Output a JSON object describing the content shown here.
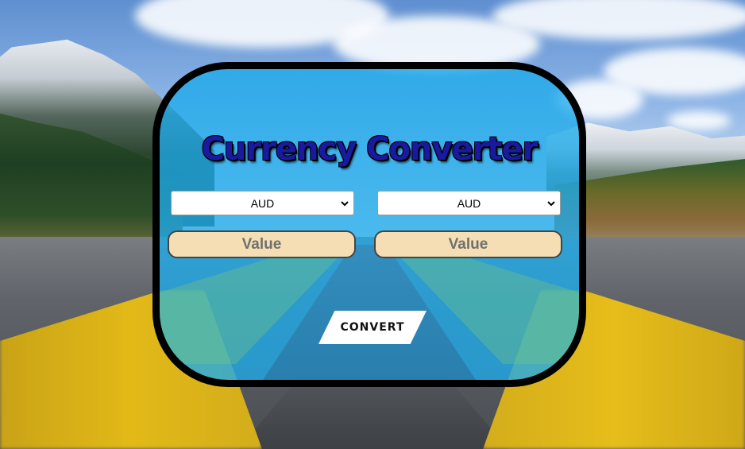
{
  "converter": {
    "title": "Currency Converter",
    "from_select": {
      "selected": "AUD",
      "icon": "chevron-down-icon"
    },
    "to_select": {
      "selected": "AUD",
      "icon": "chevron-down-icon"
    },
    "from_value": {
      "placeholder": "Value"
    },
    "to_value": {
      "placeholder": "Value"
    },
    "convert_label": "CONVERT"
  },
  "colors": {
    "card_bg": "#1eaaeb",
    "title": "#1a1aa0",
    "input_bg": "#f5deb3",
    "button_bg": "#ffffff",
    "card_border": "#000000"
  }
}
